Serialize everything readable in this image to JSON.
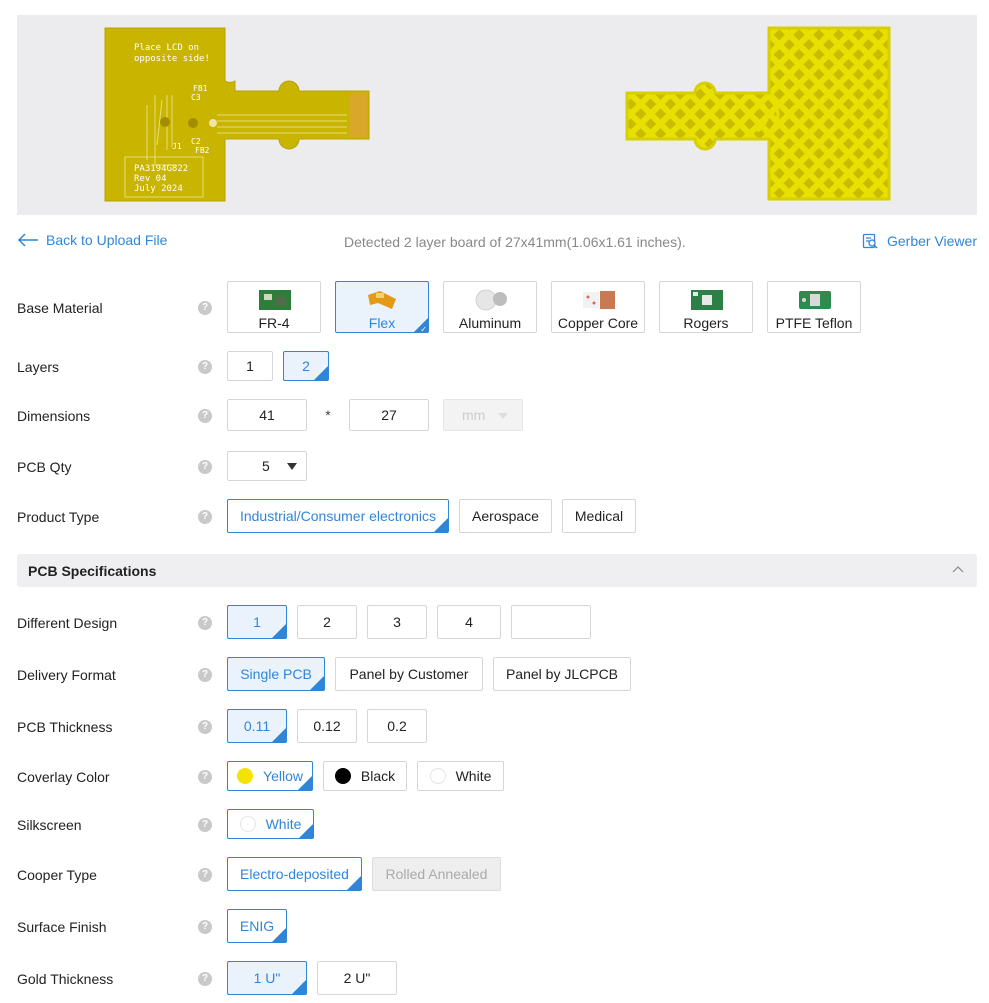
{
  "preview": {
    "front_text_1": "Place LCD on",
    "front_text_2": "opposite side!",
    "front_label_fb1": "FB1",
    "front_label_c3": "C3",
    "front_label_c2": "C2",
    "front_label_fb2": "FB2",
    "front_label_j1": "J1",
    "front_label_block_1": "PA3194G822",
    "front_label_block_2": "Rev 04",
    "front_label_block_3": "July 2024",
    "board_color": "#c9b400",
    "back_color": "#e8e000"
  },
  "infobar": {
    "back_label": "Back to Upload File",
    "detected_text": "Detected 2 layer board of 27x41mm(1.06x1.61 inches).",
    "gerber_label": "Gerber Viewer"
  },
  "colors": {
    "accent": "#2f86d9"
  },
  "form": {
    "base_material": {
      "label": "Base Material",
      "options": [
        "FR-4",
        "Flex",
        "Aluminum",
        "Copper Core",
        "Rogers",
        "PTFE Teflon"
      ],
      "selected": "Flex"
    },
    "layers": {
      "label": "Layers",
      "options": [
        "1",
        "2"
      ],
      "selected": "2"
    },
    "dimensions": {
      "label": "Dimensions",
      "length": "41",
      "width": "27",
      "separator": "*",
      "unit": "mm"
    },
    "pcb_qty": {
      "label": "PCB Qty",
      "value": "5"
    },
    "product_type": {
      "label": "Product Type",
      "options": [
        "Industrial/Consumer electronics",
        "Aerospace",
        "Medical"
      ],
      "selected": "Industrial/Consumer electronics"
    }
  },
  "section": {
    "title": "PCB Specifications"
  },
  "specs": {
    "different_design": {
      "label": "Different Design",
      "options": [
        "1",
        "2",
        "3",
        "4",
        ""
      ],
      "selected": "1"
    },
    "delivery_format": {
      "label": "Delivery Format",
      "options": [
        "Single PCB",
        "Panel by Customer",
        "Panel by JLCPCB"
      ],
      "selected": "Single PCB"
    },
    "pcb_thickness": {
      "label": "PCB Thickness",
      "options": [
        "0.11",
        "0.12",
        "0.2"
      ],
      "selected": "0.11"
    },
    "coverlay_color": {
      "label": "Coverlay Color",
      "options": [
        {
          "name": "Yellow",
          "swatch": "#f4e200"
        },
        {
          "name": "Black",
          "swatch": "#000000"
        },
        {
          "name": "White",
          "swatch": "#ffffff"
        }
      ],
      "selected": "Yellow"
    },
    "silkscreen": {
      "label": "Silkscreen",
      "options": [
        {
          "name": "White",
          "swatch": "#ffffff"
        }
      ],
      "selected": "White"
    },
    "cooper_type": {
      "label": "Cooper Type",
      "options": [
        "Electro-deposited",
        "Rolled Annealed"
      ],
      "selected": "Electro-deposited",
      "disabled": "Rolled Annealed"
    },
    "surface_finish": {
      "label": "Surface Finish",
      "options": [
        "ENIG"
      ],
      "selected": "ENIG"
    },
    "gold_thickness": {
      "label": "Gold Thickness",
      "options": [
        "1 U\"",
        "2 U\""
      ],
      "selected": "1 U\""
    }
  }
}
